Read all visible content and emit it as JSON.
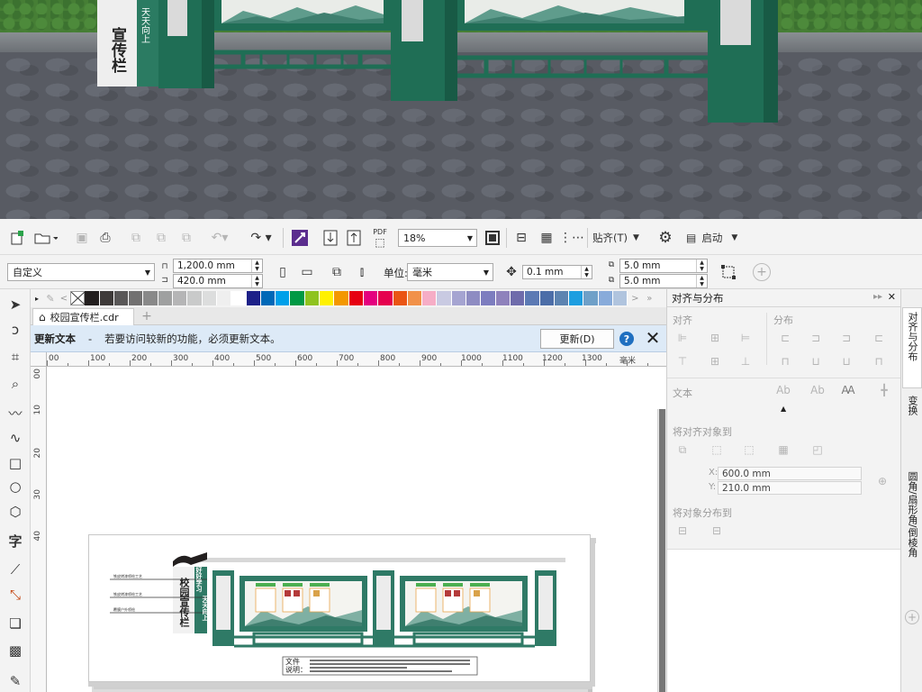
{
  "render": {
    "sign_text": "宣传栏",
    "banner_text": "天天向上"
  },
  "toolbar": {
    "zoom": "18%",
    "snap_label": "贴齐(T)",
    "launch_label": "启动",
    "pdf_label": "PDF"
  },
  "propbar": {
    "preset": "自定义",
    "width": "1,200.0 mm",
    "height": "420.0 mm",
    "unit_label": "单位:",
    "unit": "毫米",
    "nudge": "0.1 mm",
    "dup_x": "5.0 mm",
    "dup_y": "5.0 mm"
  },
  "palette": [
    "#ffffff",
    "#231f1f",
    "#3e3a39",
    "#595757",
    "#727171",
    "#898989",
    "#9fa0a0",
    "#b5b5b6",
    "#c9caca",
    "#dcdddd",
    "#efefef",
    "#ffffff",
    "#1d2088",
    "#0068b7",
    "#00a0e9",
    "#009944",
    "#8fc31f",
    "#fff100",
    "#f39800",
    "#e60012",
    "#e4007f",
    "#e5004f",
    "#ea5514",
    "#f19149",
    "#f6adc6",
    "#c9cae2",
    "#a5a4d1",
    "#8e8cc2",
    "#7d7dbf",
    "#8f82bc",
    "#6f6cab",
    "#5c7ab4",
    "#4c6ea8",
    "#5d84b1",
    "#1d9ee0",
    "#6fa0c8",
    "#88abda",
    "#b0c4de"
  ],
  "doc_tab": "校园宣传栏.cdr",
  "notice": {
    "title": "更新文本",
    "dash": "-",
    "message": "若要访问较新的功能，必须更新文本。",
    "button": "更新(D)"
  },
  "ruler_h": [
    "00",
    "100",
    "200",
    "300",
    "400",
    "500",
    "600",
    "700",
    "800",
    "900",
    "1000",
    "1100",
    "1200",
    "1300",
    "毫米"
  ],
  "ruler_v": [
    "00",
    "10",
    "20",
    "30",
    "40"
  ],
  "docker": {
    "title": "对齐与分布",
    "align_label": "对齐",
    "distribute_label": "分布",
    "text_label": "文本",
    "align_to_label": "将对齐对象到",
    "x_label": "X:",
    "x_value": "600.0 mm",
    "y_label": "Y:",
    "y_value": "210.0 mm",
    "distribute_to_label": "将对象分布到"
  },
  "side_tabs": [
    "对齐与分布",
    "变换",
    "圆角/扇形角/倒棱角"
  ],
  "design": {
    "title": "校园宣传栏",
    "slogan_left": "好好学习",
    "slogan_right": "天天向上",
    "note_label_1": "文件",
    "note_label_2": "说明：",
    "annotations": [
      "铁皮烤漆喷绘工艺",
      "铁皮烤漆喷绘工艺",
      "覆膜户外喷绘"
    ]
  },
  "colors": {
    "brand_green": "#2f7a66",
    "notice_bg": "#ddeaf7"
  }
}
